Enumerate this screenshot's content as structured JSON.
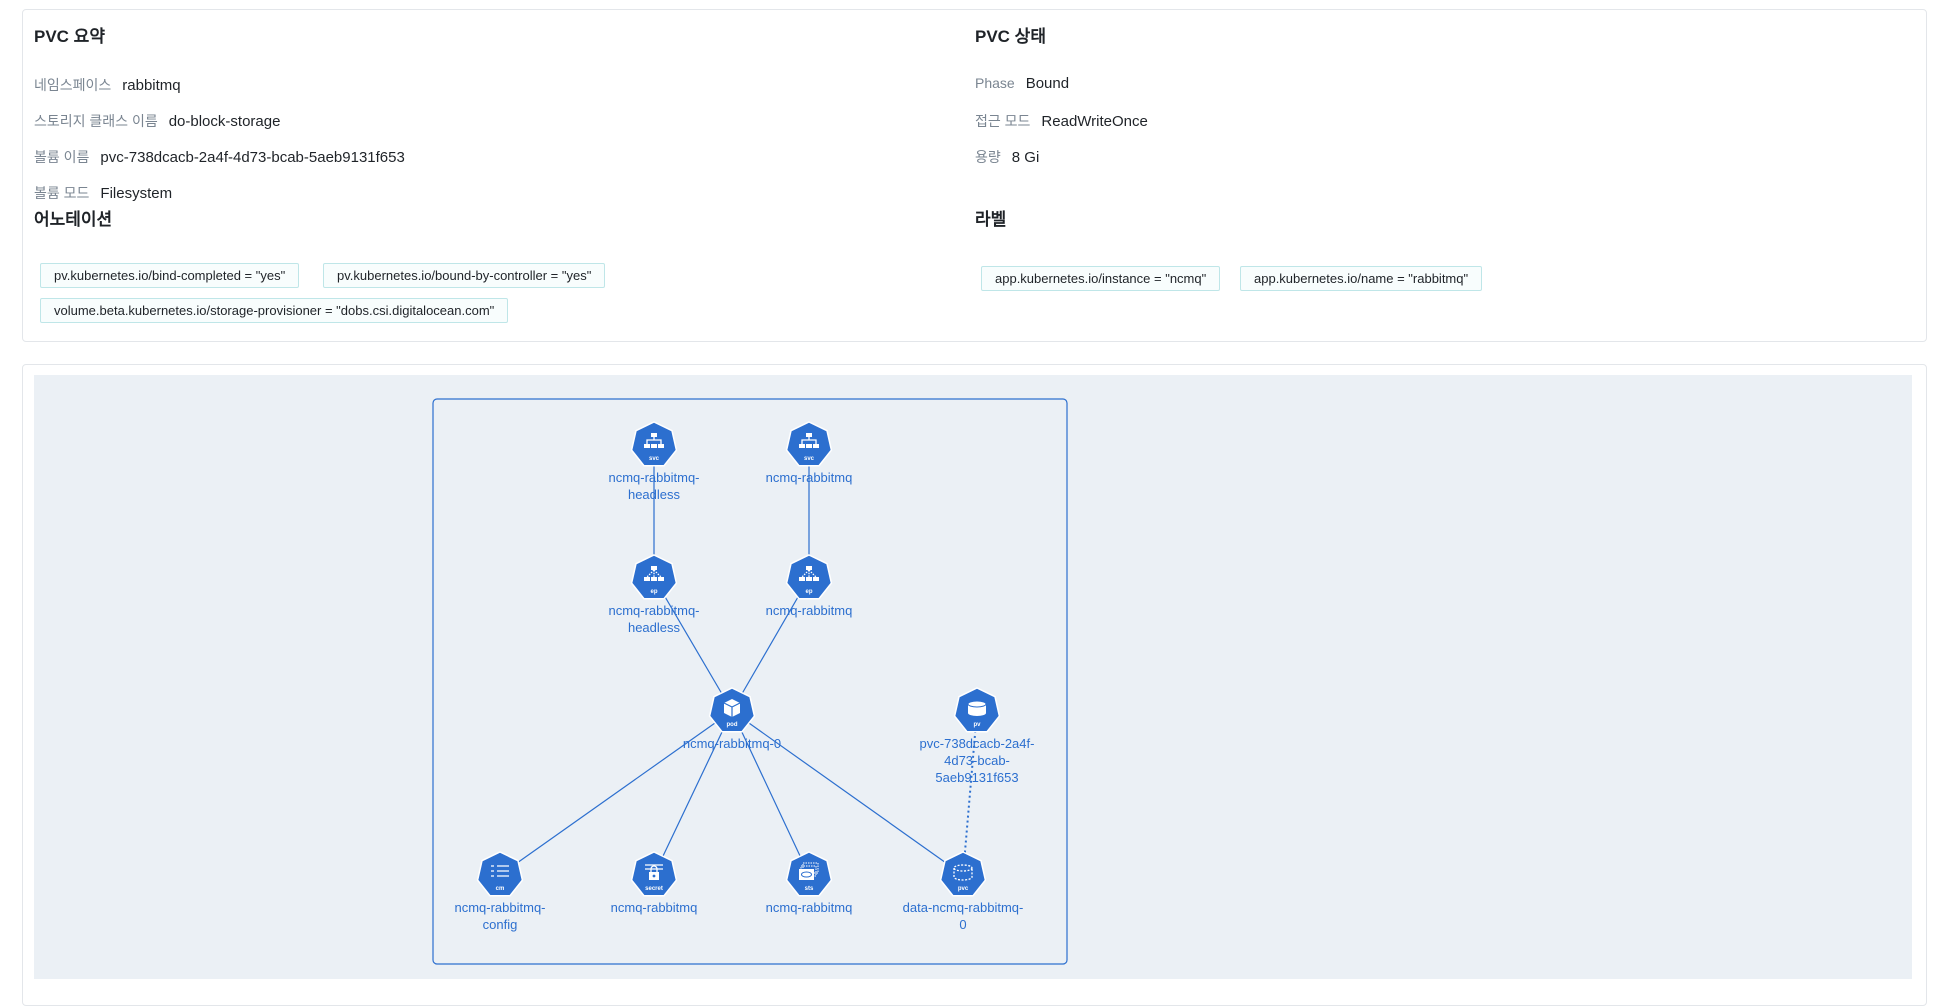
{
  "summary": {
    "title": "PVC 요약",
    "fields": [
      {
        "key": "네임스페이스",
        "value": "rabbitmq"
      },
      {
        "key": "스토리지 클래스 이름",
        "value": "do-block-storage"
      },
      {
        "key": "볼륨 이름",
        "value": "pvc-738dcacb-2a4f-4d73-bcab-5aeb9131f653"
      },
      {
        "key": "볼륨 모드",
        "value": "Filesystem"
      }
    ]
  },
  "status": {
    "title": "PVC 상태",
    "fields": [
      {
        "key": "Phase",
        "value": "Bound"
      },
      {
        "key": "접근 모드",
        "value": "ReadWriteOnce"
      },
      {
        "key": "용량",
        "value": "8 Gi"
      }
    ]
  },
  "annotations": {
    "title": "어노테이션",
    "items": [
      "pv.kubernetes.io/bind-completed = \"yes\"",
      "pv.kubernetes.io/bound-by-controller = \"yes\"",
      "volume.beta.kubernetes.io/storage-provisioner = \"dobs.csi.digitalocean.com\""
    ]
  },
  "labels": {
    "title": "라벨",
    "items": [
      "app.kubernetes.io/instance = \"ncmq\"",
      "app.kubernetes.io/name = \"rabbitmq\""
    ]
  },
  "graph": {
    "node_color": "#2c6fcf",
    "nodes": [
      {
        "id": "svc-headless",
        "kind": "svc",
        "icon": "service-icon",
        "label_lines": [
          "ncmq-rabbitmq-",
          "headless"
        ]
      },
      {
        "id": "svc-main",
        "kind": "svc",
        "icon": "service-icon",
        "label_lines": [
          "ncmq-rabbitmq"
        ]
      },
      {
        "id": "ep-headless",
        "kind": "ep",
        "icon": "endpoints-icon",
        "label_lines": [
          "ncmq-rabbitmq-",
          "headless"
        ]
      },
      {
        "id": "ep-main",
        "kind": "ep",
        "icon": "endpoints-icon",
        "label_lines": [
          "ncmq-rabbitmq"
        ]
      },
      {
        "id": "pod",
        "kind": "pod",
        "icon": "pod-icon",
        "label_lines": [
          "ncmq-rabbitmq-0"
        ]
      },
      {
        "id": "pv",
        "kind": "pv",
        "icon": "persistent-volume-icon",
        "label_lines": [
          "pvc-738dcacb-2a4f-",
          "4d73-bcab-",
          "5aeb9131f653"
        ]
      },
      {
        "id": "cm",
        "kind": "cm",
        "icon": "configmap-icon",
        "label_lines": [
          "ncmq-rabbitmq-",
          "config"
        ]
      },
      {
        "id": "secret",
        "kind": "secret",
        "icon": "secret-icon",
        "label_lines": [
          "ncmq-rabbitmq"
        ]
      },
      {
        "id": "sts",
        "kind": "sts",
        "icon": "statefulset-icon",
        "label_lines": [
          "ncmq-rabbitmq"
        ]
      },
      {
        "id": "pvc",
        "kind": "pvc",
        "icon": "persistent-volume-claim-icon",
        "label_lines": [
          "data-ncmq-rabbitmq-",
          "0"
        ]
      }
    ],
    "edges": [
      {
        "from": "svc-headless",
        "to": "ep-headless",
        "style": "solid"
      },
      {
        "from": "svc-main",
        "to": "ep-main",
        "style": "solid"
      },
      {
        "from": "ep-headless",
        "to": "pod",
        "style": "solid"
      },
      {
        "from": "ep-main",
        "to": "pod",
        "style": "solid"
      },
      {
        "from": "pod",
        "to": "cm",
        "style": "solid"
      },
      {
        "from": "pod",
        "to": "secret",
        "style": "solid"
      },
      {
        "from": "pod",
        "to": "sts",
        "style": "solid"
      },
      {
        "from": "pod",
        "to": "pvc",
        "style": "solid"
      },
      {
        "from": "pv",
        "to": "pvc",
        "style": "dotted"
      }
    ]
  }
}
